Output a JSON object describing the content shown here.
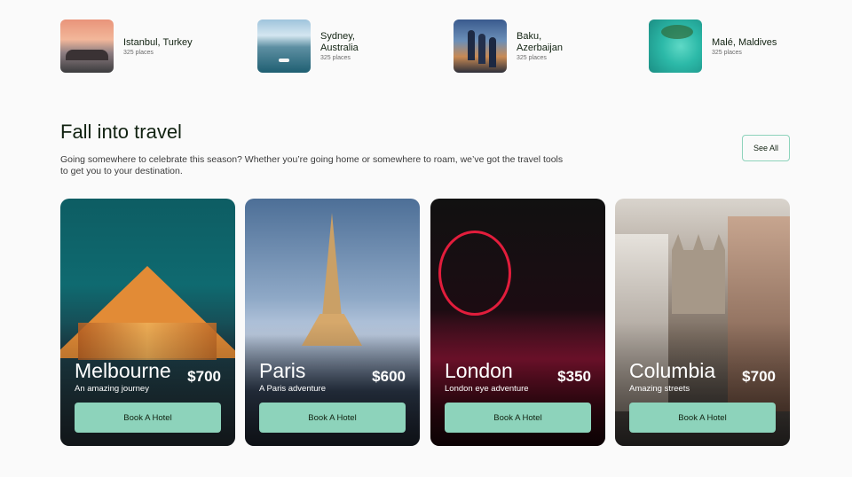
{
  "destinations": [
    {
      "name": "Istanbul, Turkey",
      "places": "325 places"
    },
    {
      "name": "Sydney, Australia",
      "places": "325 places"
    },
    {
      "name": "Baku, Azerbaijan",
      "places": "325 places"
    },
    {
      "name": "Malé, Maldives",
      "places": "325 places"
    }
  ],
  "section": {
    "title": "Fall into travel",
    "description": "Going somewhere to celebrate this season? Whether you’re going home or somewhere to roam, we’ve got the travel tools to get you to your destination.",
    "see_all": "See All"
  },
  "cards": [
    {
      "city": "Melbourne",
      "tagline": "An amazing journey",
      "price": "$700",
      "button": "Book A Hotel"
    },
    {
      "city": "Paris",
      "tagline": "A Paris adventure",
      "price": "$600",
      "button": "Book A Hotel"
    },
    {
      "city": "London",
      "tagline": "London eye adventure",
      "price": "$350",
      "button": "Book A Hotel"
    },
    {
      "city": "Columbia",
      "tagline": "Amazing streets",
      "price": "$700",
      "button": "Book A Hotel"
    }
  ],
  "colors": {
    "accent": "#8dd3bb",
    "text": "#112211",
    "background": "#fafafa"
  }
}
